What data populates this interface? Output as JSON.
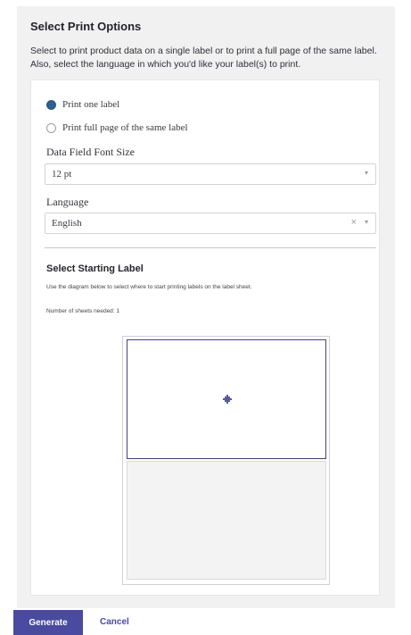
{
  "panel": {
    "title": "Select Print Options",
    "description": "Select to print product data on a single label or to print a full page of the same label. Also, select the language in which you'd like your label(s) to print."
  },
  "print_mode": {
    "options": [
      {
        "label": "Print one label",
        "checked": true
      },
      {
        "label": "Print full page of the same label",
        "checked": false
      }
    ]
  },
  "font_size": {
    "label": "Data Field Font Size",
    "value": "12 pt"
  },
  "language": {
    "label": "Language",
    "value": "English",
    "clear_glyph": "×",
    "caret_glyph": "▾"
  },
  "starting_label": {
    "title": "Select Starting Label",
    "hint": "Use the diagram below to select where to start printing labels on the label sheet.",
    "sheets_needed": "Number of sheets needed: 1",
    "sheet_labels": [
      {
        "selected": true,
        "icon": "target-icon"
      },
      {
        "selected": false
      }
    ]
  },
  "actions": {
    "generate": "Generate",
    "cancel": "Cancel"
  },
  "colors": {
    "accent": "#4a4aa0",
    "radio_selected": "#2c5b8c",
    "panel_bg": "#f1f1f2"
  }
}
